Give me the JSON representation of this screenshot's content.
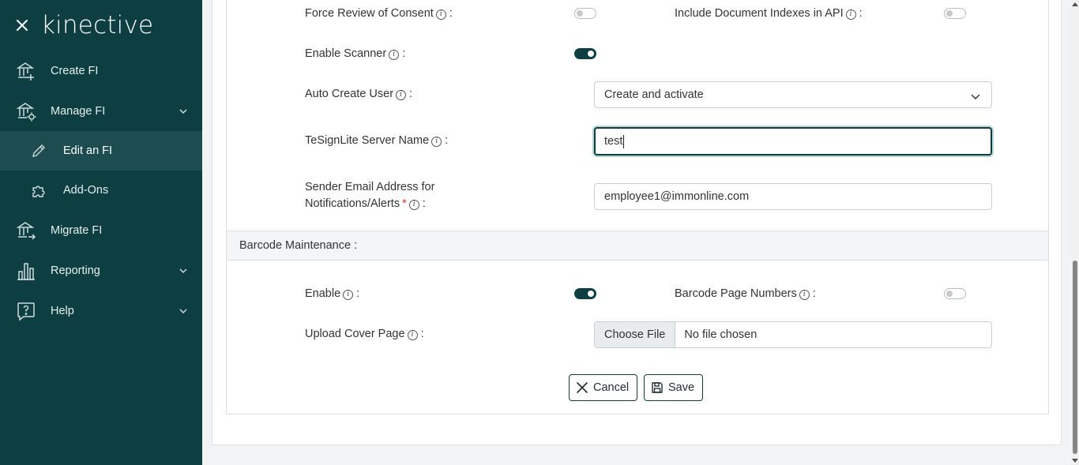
{
  "brand": {
    "logo_text": "kinective"
  },
  "sidebar": {
    "items": [
      {
        "label": "Create FI",
        "icon": "bank-plus-icon"
      },
      {
        "label": "Manage FI",
        "icon": "bank-gear-icon"
      },
      {
        "label": "Edit an FI",
        "icon": "pencil-icon"
      },
      {
        "label": "Add-Ons",
        "icon": "puzzle-icon"
      },
      {
        "label": "Migrate FI",
        "icon": "bank-arrow-icon"
      },
      {
        "label": "Reporting",
        "icon": "bar-chart-icon"
      },
      {
        "label": "Help",
        "icon": "help-bubble-icon"
      }
    ]
  },
  "form": {
    "force_review_label": "Force Review of Consent",
    "include_indexes_label": "Include Document Indexes in API",
    "enable_scanner_label": "Enable Scanner",
    "auto_create_label": "Auto Create User",
    "auto_create_value": "Create and activate",
    "tesign_label": "TeSignLite Server Name",
    "tesign_value": "test",
    "sender_label_line1": "Sender Email Address for",
    "sender_label_line2": "Notifications/Alerts",
    "sender_value": "employee1@immonline.com",
    "required_mark": "*",
    "colon": ":",
    "info_glyph": "i"
  },
  "barcode": {
    "section_title": "Barcode Maintenance :",
    "enable_label": "Enable",
    "page_numbers_label": "Barcode Page Numbers",
    "upload_label": "Upload Cover Page",
    "choose_file": "Choose File",
    "no_file": "No file chosen"
  },
  "actions": {
    "cancel": "Cancel",
    "save": "Save"
  },
  "toggles": {
    "force_review": false,
    "include_indexes": false,
    "enable_scanner": true,
    "barcode_enable": true,
    "barcode_page_numbers": false
  },
  "colors": {
    "sidebar_bg": "#0d3f42",
    "sidebar_active": "#1d4d50",
    "accent": "#0d3f42",
    "required": "#d0312d"
  }
}
